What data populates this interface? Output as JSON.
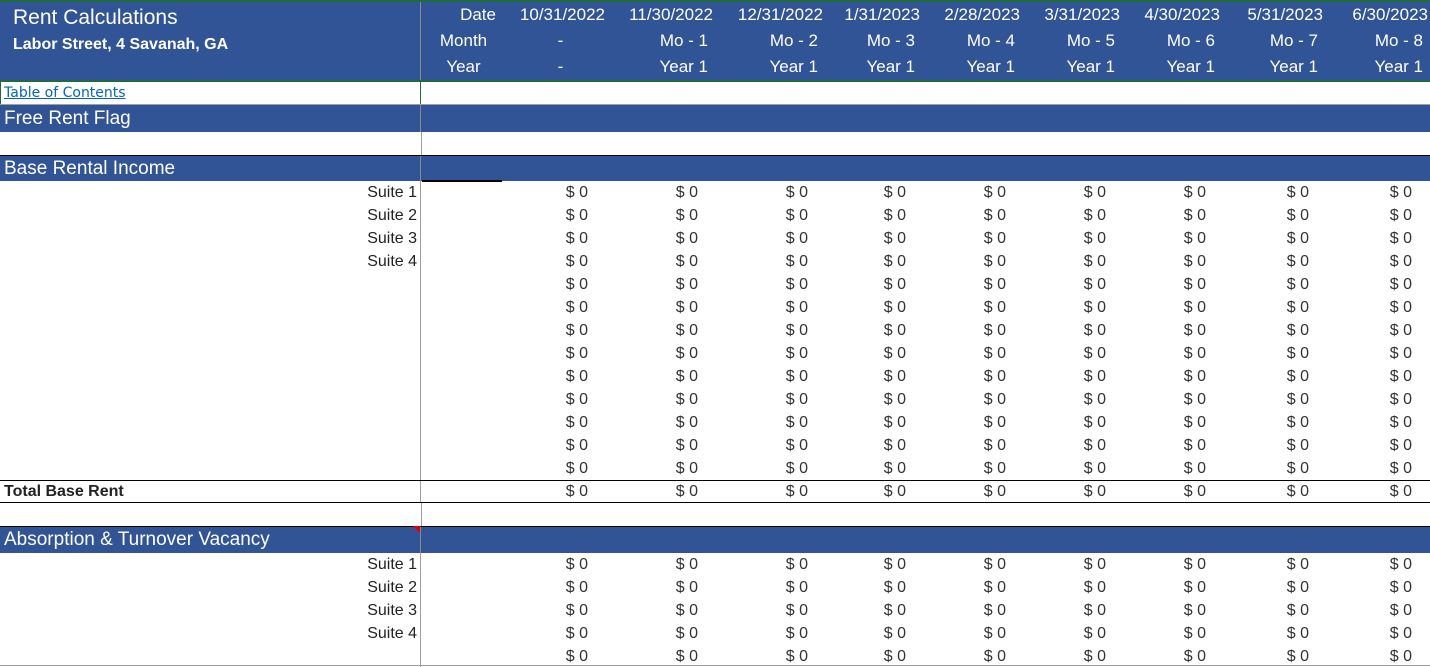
{
  "header": {
    "title": "Rent Calculations",
    "subtitle": "Labor Street, 4 Savanah, GA",
    "row_labels": {
      "date": "Date",
      "month": "Month",
      "year": "Year"
    },
    "columns": [
      {
        "date": "10/31/2022",
        "month": "-",
        "year": "-"
      },
      {
        "date": "11/30/2022",
        "month": "Mo - 1",
        "year": "Year 1"
      },
      {
        "date": "12/31/2022",
        "month": "Mo - 2",
        "year": "Year 1"
      },
      {
        "date": "1/31/2023",
        "month": "Mo - 3",
        "year": "Year 1"
      },
      {
        "date": "2/28/2023",
        "month": "Mo - 4",
        "year": "Year 1"
      },
      {
        "date": "3/31/2023",
        "month": "Mo - 5",
        "year": "Year 1"
      },
      {
        "date": "4/30/2023",
        "month": "Mo - 6",
        "year": "Year 1"
      },
      {
        "date": "5/31/2023",
        "month": "Mo - 7",
        "year": "Year 1"
      },
      {
        "date": "6/30/2023",
        "month": "Mo - 8",
        "year": "Year 1"
      }
    ]
  },
  "toc_link": "Table of Contents",
  "sections": {
    "free_rent_flag": {
      "title": "Free Rent Flag"
    },
    "base_rental_income": {
      "title": "Base Rental Income",
      "rows": [
        {
          "label": "Suite 1",
          "values": [
            "$ 0",
            "$ 0",
            "$ 0",
            "$ 0",
            "$ 0",
            "$ 0",
            "$ 0",
            "$ 0",
            "$ 0"
          ]
        },
        {
          "label": "Suite 2",
          "values": [
            "$ 0",
            "$ 0",
            "$ 0",
            "$ 0",
            "$ 0",
            "$ 0",
            "$ 0",
            "$ 0",
            "$ 0"
          ]
        },
        {
          "label": "Suite 3",
          "values": [
            "$ 0",
            "$ 0",
            "$ 0",
            "$ 0",
            "$ 0",
            "$ 0",
            "$ 0",
            "$ 0",
            "$ 0"
          ]
        },
        {
          "label": "Suite 4",
          "values": [
            "$ 0",
            "$ 0",
            "$ 0",
            "$ 0",
            "$ 0",
            "$ 0",
            "$ 0",
            "$ 0",
            "$ 0"
          ]
        },
        {
          "label": "",
          "values": [
            "$ 0",
            "$ 0",
            "$ 0",
            "$ 0",
            "$ 0",
            "$ 0",
            "$ 0",
            "$ 0",
            "$ 0"
          ]
        },
        {
          "label": "",
          "values": [
            "$ 0",
            "$ 0",
            "$ 0",
            "$ 0",
            "$ 0",
            "$ 0",
            "$ 0",
            "$ 0",
            "$ 0"
          ]
        },
        {
          "label": "",
          "values": [
            "$ 0",
            "$ 0",
            "$ 0",
            "$ 0",
            "$ 0",
            "$ 0",
            "$ 0",
            "$ 0",
            "$ 0"
          ]
        },
        {
          "label": "",
          "values": [
            "$ 0",
            "$ 0",
            "$ 0",
            "$ 0",
            "$ 0",
            "$ 0",
            "$ 0",
            "$ 0",
            "$ 0"
          ]
        },
        {
          "label": "",
          "values": [
            "$ 0",
            "$ 0",
            "$ 0",
            "$ 0",
            "$ 0",
            "$ 0",
            "$ 0",
            "$ 0",
            "$ 0"
          ]
        },
        {
          "label": "",
          "values": [
            "$ 0",
            "$ 0",
            "$ 0",
            "$ 0",
            "$ 0",
            "$ 0",
            "$ 0",
            "$ 0",
            "$ 0"
          ]
        },
        {
          "label": "",
          "values": [
            "$ 0",
            "$ 0",
            "$ 0",
            "$ 0",
            "$ 0",
            "$ 0",
            "$ 0",
            "$ 0",
            "$ 0"
          ]
        },
        {
          "label": "",
          "values": [
            "$ 0",
            "$ 0",
            "$ 0",
            "$ 0",
            "$ 0",
            "$ 0",
            "$ 0",
            "$ 0",
            "$ 0"
          ]
        },
        {
          "label": "",
          "values": [
            "$ 0",
            "$ 0",
            "$ 0",
            "$ 0",
            "$ 0",
            "$ 0",
            "$ 0",
            "$ 0",
            "$ 0"
          ]
        }
      ],
      "total": {
        "label": "Total Base Rent",
        "values": [
          "$ 0",
          "$ 0",
          "$ 0",
          "$ 0",
          "$ 0",
          "$ 0",
          "$ 0",
          "$ 0",
          "$ 0"
        ]
      }
    },
    "absorption_turnover_vacancy": {
      "title": "Absorption & Turnover Vacancy",
      "rows": [
        {
          "label": "Suite 1",
          "values": [
            "$ 0",
            "$ 0",
            "$ 0",
            "$ 0",
            "$ 0",
            "$ 0",
            "$ 0",
            "$ 0",
            "$ 0"
          ]
        },
        {
          "label": "Suite 2",
          "values": [
            "$ 0",
            "$ 0",
            "$ 0",
            "$ 0",
            "$ 0",
            "$ 0",
            "$ 0",
            "$ 0",
            "$ 0"
          ]
        },
        {
          "label": "Suite 3",
          "values": [
            "$ 0",
            "$ 0",
            "$ 0",
            "$ 0",
            "$ 0",
            "$ 0",
            "$ 0",
            "$ 0",
            "$ 0"
          ]
        },
        {
          "label": "Suite 4",
          "values": [
            "$ 0",
            "$ 0",
            "$ 0",
            "$ 0",
            "$ 0",
            "$ 0",
            "$ 0",
            "$ 0",
            "$ 0"
          ]
        },
        {
          "label": "",
          "values": [
            "$ 0",
            "$ 0",
            "$ 0",
            "$ 0",
            "$ 0",
            "$ 0",
            "$ 0",
            "$ 0",
            "$ 0"
          ]
        }
      ]
    }
  },
  "colors": {
    "header_blue": "#305496",
    "link_blue": "#0563c1",
    "selection_green": "#1f6b3a",
    "comment_marker_red": "#e00000"
  }
}
